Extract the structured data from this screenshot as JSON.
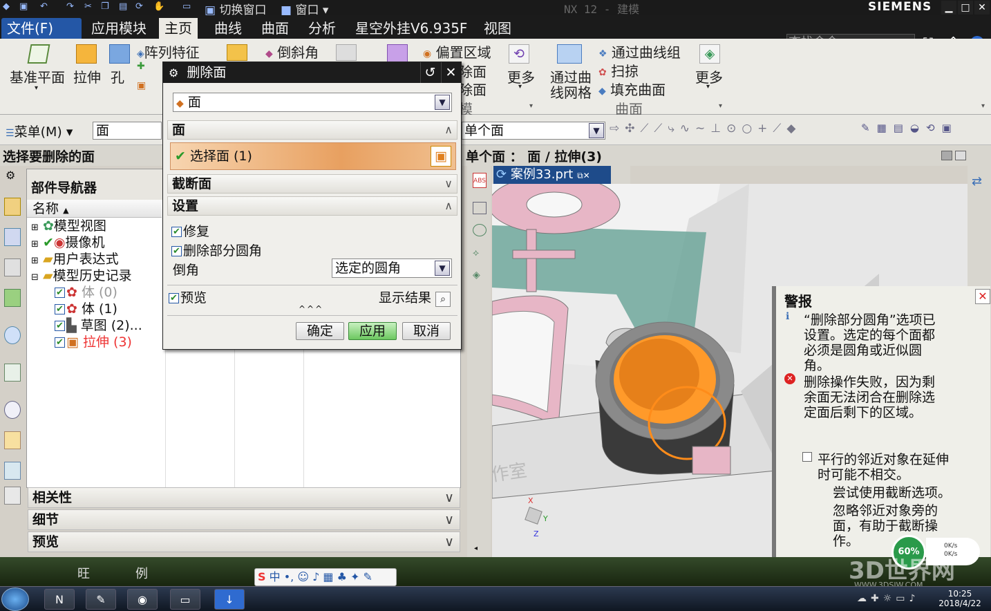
{
  "window": {
    "title": "NX 12 - 建模",
    "brand": "SIEMENS",
    "quick_switch": "切换窗口",
    "window_menu": "窗口"
  },
  "menu_tabs": [
    "文件(F)",
    "应用模块",
    "主页",
    "曲线",
    "曲面",
    "分析",
    "星空外挂V6.935F",
    "视图"
  ],
  "search_placeholder": "查找命令",
  "ribbon": {
    "datum_plane": "基准平面",
    "extrude": "拉伸",
    "hole": "孔",
    "pattern_feature": "阵列特征",
    "chamfer": "倒斜角",
    "offset_region": "偏置区域",
    "face_a": "除面",
    "face_b": "除面",
    "model": "模",
    "more1": "更多",
    "through_curve_mesh_1": "通过曲",
    "through_curve_mesh_2": "线网格",
    "through_curves": "通过曲线组",
    "sweep": "扫掠",
    "fill_surface": "填充曲面",
    "surface_group": "曲面",
    "more2": "更多"
  },
  "toolbar2": {
    "menu": "菜单(M)",
    "filter": "面",
    "selection_scope": "单个面"
  },
  "cue_line": "选择要删除的面",
  "status_line": "单个面 ： 面 / 拉伸(3)",
  "navigator": {
    "title": "部件导航器",
    "column_name": "名称",
    "rows": [
      {
        "label": "模型视图"
      },
      {
        "label": "摄像机"
      },
      {
        "label": "用户表达式"
      },
      {
        "label": "模型历史记录"
      },
      {
        "label": "体 (0)"
      },
      {
        "label": "体 (1)"
      },
      {
        "label": "草图 (2)..."
      },
      {
        "label": "拉伸 (3)"
      }
    ],
    "panels": [
      "相关性",
      "细节",
      "预览"
    ]
  },
  "viewport": {
    "tab": "案例33.prt",
    "watermark": "作室",
    "axis_x": "X",
    "axis_y": "Y",
    "axis_z": "Z"
  },
  "dialog": {
    "title": "删除面",
    "type_value": "面",
    "sec_face": "面",
    "select_face": "选择面 (1)",
    "sec_cap": "截断面",
    "sec_settings": "设置",
    "repair": "修复",
    "delete_partial_blend": "删除部分圆角",
    "blend_label": "倒角",
    "blend_value": "选定的圆角",
    "preview": "预览",
    "show_result": "显示结果",
    "ok": "确定",
    "apply": "应用",
    "cancel": "取消"
  },
  "alert": {
    "title": "警报",
    "info": "“删除部分圆角”选项已设置。选定的每个面都必须是圆角或近似圆角。",
    "error": "删除操作失败，因为剩余面无法闭合在删除选定面后剩下的区域。",
    "note": "平行的邻近对象在延伸时可能不相交。",
    "tip1": "尝试使用截断选项。",
    "tip2": "忽略邻近对象旁的面，有助于截断操作。"
  },
  "desktop": {
    "label1": "旺",
    "label2": "例",
    "ime": "中",
    "badge_percent": "60%",
    "net_up": "0K/s",
    "net_down": "0K/s"
  },
  "taskbar": {
    "time": "10:25",
    "date": "2018/4/22"
  },
  "watermark_brand": "3D世界网",
  "watermark_url": "WWW.3DSJW.COM"
}
